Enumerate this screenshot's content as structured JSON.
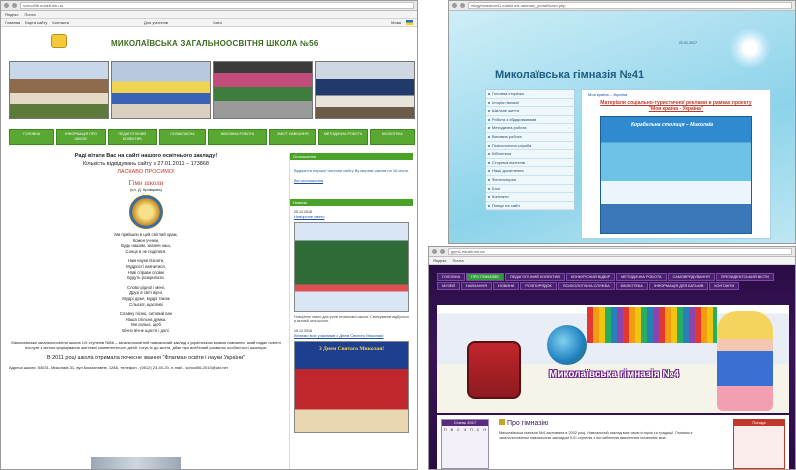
{
  "shot1": {
    "url": "school56.edukit.mk.ua",
    "bar": [
      "Яндекс",
      "Почта"
    ],
    "tabs": [
      "Главная",
      "Карта сайту",
      "Контакти",
      "Для учителів",
      "Чати"
    ],
    "lang_label": "Мова",
    "title": "МИКОЛАЇВСЬКА ЗАГАЛЬНООСВІТНЯ ШКОЛА №56",
    "nav": [
      "ГОЛОВНА",
      "ІНФОРМАЦІЯ ПРО ШКОЛУ",
      "ПЕДАГОГІЧНИЙ КОЛЕКТИВ",
      "ПОЗАКЛАСНА",
      "ВИХОВНА РОБОТА",
      "ЗМІСТ НАВЧАННЯ",
      "МЕТОДИЧНА РОБОТА",
      "БІБЛІОТЕКА"
    ],
    "welcome": "Раді вітати Вас на сайті нашого освітнього закладу!",
    "counter": "Кількість відвідувань сайту з 27.01.2011 – 173868",
    "welcome2": "ЛАСКАВО ПРОСИМО!",
    "anthem_title": "Гімн школи",
    "anthem_author": "(сл. Д. Кривцова)",
    "poem": [
      "Ми прийшли в цей світлий храм,",
      "Кожен учнем,",
      "Будь нашим, знання наш,",
      "Сонце в не поділися.",
      "",
      "Нам науки пізнати,",
      "Мудрості навчитися,",
      "Нові справи сповні",
      "Будуть розкрилати.",
      "",
      "Слово рідної і мені,",
      "Друзі в світі вірні,",
      "Мудрі дуже, мудрі також",
      "Сльозої, щасливі",
      "",
      "Славну пісню, ситовий ван",
      "Наша спільна думка.",
      "Ми сильні, щоб",
      "Вічно вічне щастя і долі."
    ],
    "about": "Миколаївська загальноосвітня школа І-ІІІ ступенів №56 – загальноосвітній навчальний заклад з українською мовою навчання, який надає освітні послуги з метою формування життєвої компетентності дітей, готує їх до життя, дбає про всебічний розвиток особистості школяра.",
    "award": "В 2011 році школа отримала почесне звання \"Флагман освіти і науки України\"",
    "address": "Адреса школи: 54031, Миколаїв-31, вул.Космонавтів, 128А, телефон - (0512) 23-40-20, e-mail - school56-2015@ukr.net",
    "side1_title": "Оголошення",
    "side1_text": "Відкриття першої частини сайту Ву мережі школи на 16 січня.",
    "side1_link": "Всі оголошення",
    "side2_title": "Новини",
    "news1_date": "25.12.2016",
    "news1_link": "Новорічне свято",
    "news1_text": "Новорічне свято для учнів початкової школи. Святкування відбулося в актовій залі школи.",
    "news2_date": "19.12.2016",
    "news2_text": "Вітаємо всіх учасників з Днем Святого Миколая!",
    "card_text": "З Днем Святого Миколая!"
  },
  "shot2": {
    "url": "mkgymnasium41.edukit.mk.ua/main_portal/index.php",
    "date": "22.01.2017",
    "title": "Миколаївська гімназія №41",
    "breadcrumb": "Моя країна – Україна",
    "heading": "Матеріали соціально-туристичної реклами в рамках проекту \"Моя країна - Україна\"",
    "banner": "Корабельна столиця – Миколаїв",
    "menu": [
      "Головна сторінка",
      "Історія гімназії",
      "Шкільне життя",
      "Робота з обдарованими",
      "Методична робота",
      "Виховна робота",
      "Психологічна служба",
      "Бібліотека",
      "Сторінка вчителів",
      "Наші досягнення",
      "Фотогалерея",
      "Блог",
      "Контакти",
      "Пошук на сайті"
    ]
  },
  "shot3": {
    "url": "gym4.edukit.mk.ua",
    "bar": [
      "Яндекс",
      "Почта"
    ],
    "nav": [
      "ГОЛОВНА",
      "ПРО ГІМНАЗІЮ",
      "ПЕДАГОГІЧНИЙ КОЛЕКТИВ",
      "КОНКУРСНИЙ ВІДБІР",
      "МЕТОДИЧНА РОБОТА",
      "САМОВРЯДУВАННЯ",
      "ПРЕЗИДЕНТСЬКИЙ ВІСТИ",
      "МУЗЕЙ",
      "НАВЧАННЯ",
      "НОВИНИ",
      "РОЗПОРЯДОК",
      "ПСИХОЛОГІЧНА СЛУЖБА",
      "БІБЛІОТЕКА",
      "ІНФОРМАЦІЯ ДЛЯ БАТЬКІВ",
      "КОНТАКТИ"
    ],
    "selected_nav": "ПРО ГІМНАЗІЮ",
    "title": "Миколаївська гімназія №4",
    "section": "Про гімназію",
    "text": "Миколаївська гімназія №4 заснована в 2002 році. Навчальний заклад має свою історію та традиції. Гімназія є загальноосвітнім навчальним закладом ІІ-ІІІ ступенів з поглибленим вивченням іноземних мов.",
    "calendar_title": "Січень 2017",
    "calendar_days": [
      "П",
      "В",
      "С",
      "Ч",
      "П",
      "С",
      "Н"
    ],
    "widget_title": "Погода"
  },
  "colors": {
    "green": "#58a832",
    "teal": "#3aa3c9",
    "purple": "#3a1458"
  }
}
